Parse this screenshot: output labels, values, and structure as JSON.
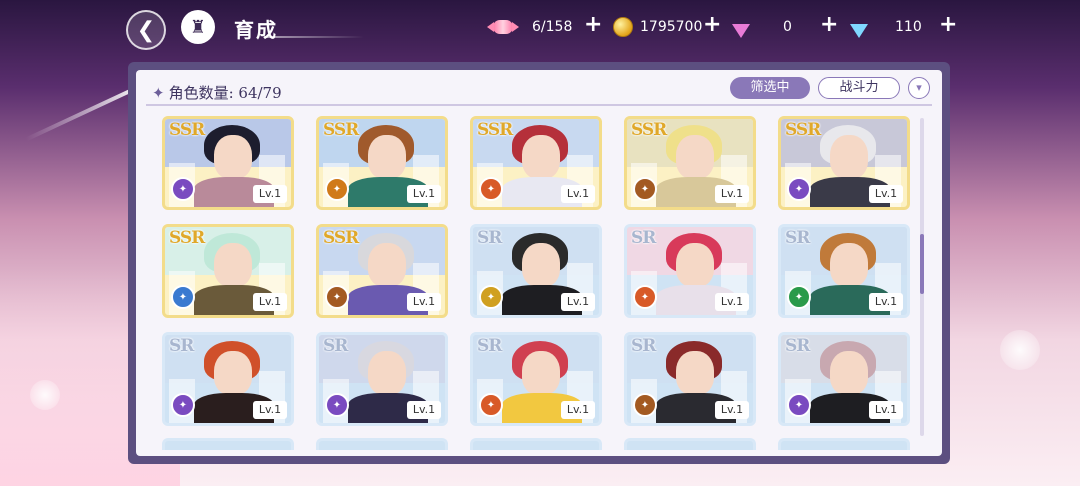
{
  "header": {
    "title": "育成",
    "back_icon": "back-arrow-icon",
    "home_icon": "castle-icon"
  },
  "resources": [
    {
      "name": "candy",
      "value": "6/158",
      "icon": "candy-icon"
    },
    {
      "name": "gold",
      "value": "1795700",
      "icon": "coin-icon"
    },
    {
      "name": "pink-gem",
      "value": "0",
      "icon": "pink-diamond-icon"
    },
    {
      "name": "blue-gem",
      "value": "110",
      "icon": "blue-diamond-icon"
    }
  ],
  "plus_label": "+",
  "panel": {
    "count_label": "角色数量: 64/79",
    "filter_label": "筛选中",
    "sort_label": "战斗力",
    "sort_toggle": "▾"
  },
  "cards": [
    {
      "rarity": "SSR",
      "level": "Lv.1",
      "element_color": "#7a4bc0",
      "hair": "#1d1d2e",
      "body": "#b98a9a",
      "sky": "#b9c8e8"
    },
    {
      "rarity": "SSR",
      "level": "Lv.1",
      "element_color": "#d07a1a",
      "hair": "#a05a2c",
      "body": "#2e7a6a",
      "sky": "#bfd6ef"
    },
    {
      "rarity": "SSR",
      "level": "Lv.1",
      "element_color": "#d85a28",
      "hair": "#b5303a",
      "body": "#e8e8f2",
      "sky": "#c8d9f0"
    },
    {
      "rarity": "SSR",
      "level": "Lv.1",
      "element_color": "#a35a22",
      "hair": "#efe08a",
      "body": "#d8c89a",
      "sky": "#e8e2c0"
    },
    {
      "rarity": "SSR",
      "level": "Lv.1",
      "element_color": "#7a4bc0",
      "hair": "#e8e8ec",
      "body": "#3a3a48",
      "sky": "#c8c8d8"
    },
    {
      "rarity": "SSR",
      "level": "Lv.1",
      "element_color": "#3a7ad0",
      "hair": "#bfe8d8",
      "body": "#6a5a3a",
      "sky": "#d8f0e8"
    },
    {
      "rarity": "SSR",
      "level": "Lv.1",
      "element_color": "#a35a22",
      "hair": "#d8d8dc",
      "body": "#6a5ab0",
      "sky": "#c8d8f0"
    },
    {
      "rarity": "SR",
      "level": "Lv.1",
      "element_color": "#d0a020",
      "hair": "#2a2a2a",
      "body": "#1e1e22",
      "sky": "#cfe0f2"
    },
    {
      "rarity": "SR",
      "level": "Lv.1",
      "element_color": "#d85a28",
      "hair": "#d83a5a",
      "body": "#e8e0ea",
      "sky": "#f0d8e4"
    },
    {
      "rarity": "SR",
      "level": "Lv.1",
      "element_color": "#2a9a4a",
      "hair": "#c07a3a",
      "body": "#2a6a5a",
      "sky": "#cfe0f2"
    },
    {
      "rarity": "SR",
      "level": "Lv.1",
      "element_color": "#7a4bc0",
      "hair": "#d0502a",
      "body": "#2a1e1e",
      "sky": "#cfe0f2"
    },
    {
      "rarity": "SR",
      "level": "Lv.1",
      "element_color": "#7a4bc0",
      "hair": "#d8d8e0",
      "body": "#2e2a48",
      "sky": "#cfd8ec"
    },
    {
      "rarity": "SR",
      "level": "Lv.1",
      "element_color": "#d85a28",
      "hair": "#d04050",
      "body": "#f2c840",
      "sky": "#cfe0f2"
    },
    {
      "rarity": "SR",
      "level": "Lv.1",
      "element_color": "#a35a22",
      "hair": "#8a2a2a",
      "body": "#2a2a30",
      "sky": "#cfe0f2"
    },
    {
      "rarity": "SR",
      "level": "Lv.1",
      "element_color": "#7a4bc0",
      "hair": "#c8a8b0",
      "body": "#1e1e22",
      "sky": "#d8dde8"
    }
  ],
  "peek_row_count": 5
}
